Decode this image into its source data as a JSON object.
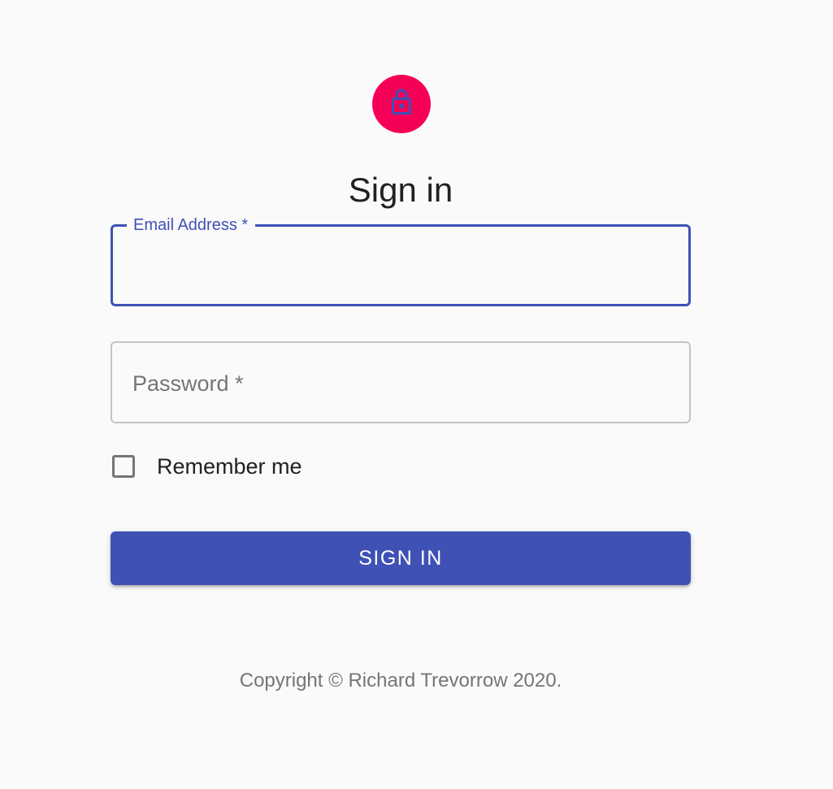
{
  "header": {
    "icon": "lock-icon",
    "title": "Sign in"
  },
  "form": {
    "email": {
      "label": "Email Address *",
      "value": ""
    },
    "password": {
      "label": "Password *",
      "value": ""
    },
    "remember": {
      "label": "Remember me",
      "checked": false
    },
    "submit_label": "Sign In"
  },
  "footer": {
    "copyright": "Copyright © Richard Trevorrow 2020."
  },
  "colors": {
    "accent": "#3f51b5",
    "avatar": "#f50057",
    "background": "#fafafa"
  }
}
